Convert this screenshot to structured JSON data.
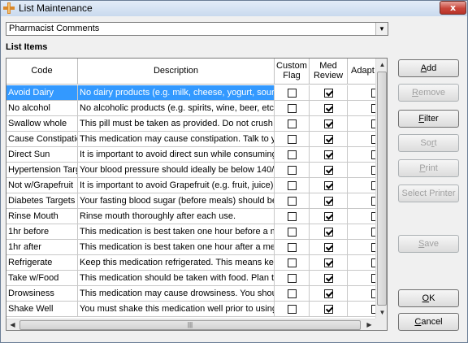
{
  "window": {
    "title": "List Maintenance",
    "close_label": "x"
  },
  "list_selector": {
    "selected": "Pharmacist Comments"
  },
  "section_label": "List Items",
  "columns": {
    "code": "Code",
    "description": "Description",
    "custom_flag_1": "Custom",
    "custom_flag_2": "Flag",
    "med_review_1": "Med",
    "med_review_2": "Review",
    "adapt": "Adapt"
  },
  "rows": [
    {
      "code": "Avoid Dairy",
      "description": "No dairy products (e.g. milk, cheese, yogurt, sour c",
      "custom_flag": false,
      "med_review": true,
      "adapt": false,
      "selected": true
    },
    {
      "code": "No alcohol",
      "description": "No alcoholic products (e.g. spirits, wine, beer, etc.)",
      "custom_flag": false,
      "med_review": true,
      "adapt": false
    },
    {
      "code": "Swallow whole",
      "description": "This pill must be taken as provided.  Do not crush",
      "custom_flag": false,
      "med_review": true,
      "adapt": false
    },
    {
      "code": "Cause Constipatio",
      "description": "This medication may cause constipation.  Talk to y",
      "custom_flag": false,
      "med_review": true,
      "adapt": false
    },
    {
      "code": "Direct Sun",
      "description": "It is important to avoid direct sun while consuming",
      "custom_flag": false,
      "med_review": true,
      "adapt": false
    },
    {
      "code": "Hypertension Targ",
      "description": "Your blood pressure should ideally be below 140/9",
      "custom_flag": false,
      "med_review": true,
      "adapt": false
    },
    {
      "code": "Not w/Grapefruit",
      "description": "It is important to avoid Grapefruit (e.g. fruit, juice) w",
      "custom_flag": false,
      "med_review": true,
      "adapt": false
    },
    {
      "code": "Diabetes Targets",
      "description": "Your fasting blood sugar (before meals) should be l",
      "custom_flag": false,
      "med_review": true,
      "adapt": false
    },
    {
      "code": "Rinse Mouth",
      "description": "Rinse mouth thoroughly after each use.",
      "custom_flag": false,
      "med_review": true,
      "adapt": false
    },
    {
      "code": "1hr before",
      "description": "This medication is best taken one hour before a me",
      "custom_flag": false,
      "med_review": true,
      "adapt": false
    },
    {
      "code": "1hr after",
      "description": "This medication is best taken one hour after a mea",
      "custom_flag": false,
      "med_review": true,
      "adapt": false
    },
    {
      "code": "Refrigerate",
      "description": "Keep this medication refrigerated.   This means kee",
      "custom_flag": false,
      "med_review": true,
      "adapt": false
    },
    {
      "code": "Take w/Food",
      "description": "This medication should be taken with food.  Plan to",
      "custom_flag": false,
      "med_review": true,
      "adapt": false
    },
    {
      "code": "Drowsiness",
      "description": "This medication may cause drowsiness.  You shou",
      "custom_flag": false,
      "med_review": true,
      "adapt": false
    },
    {
      "code": "Shake Well",
      "description": "You must shake this medication well prior to using",
      "custom_flag": false,
      "med_review": true,
      "adapt": false
    }
  ],
  "buttons": {
    "add": {
      "pre": "",
      "u": "A",
      "post": "dd"
    },
    "remove": {
      "pre": "",
      "u": "R",
      "post": "emove"
    },
    "filter": {
      "pre": "",
      "u": "F",
      "post": "ilter"
    },
    "sort": {
      "pre": "So",
      "u": "r",
      "post": "t"
    },
    "print": {
      "pre": "",
      "u": "P",
      "post": "rint"
    },
    "select_printer": {
      "pre": "Select Printer",
      "u": "",
      "post": ""
    },
    "save": {
      "pre": "",
      "u": "S",
      "post": "ave"
    },
    "ok": {
      "pre": "",
      "u": "O",
      "post": "K"
    },
    "cancel": {
      "pre": "",
      "u": "C",
      "post": "ancel"
    }
  }
}
